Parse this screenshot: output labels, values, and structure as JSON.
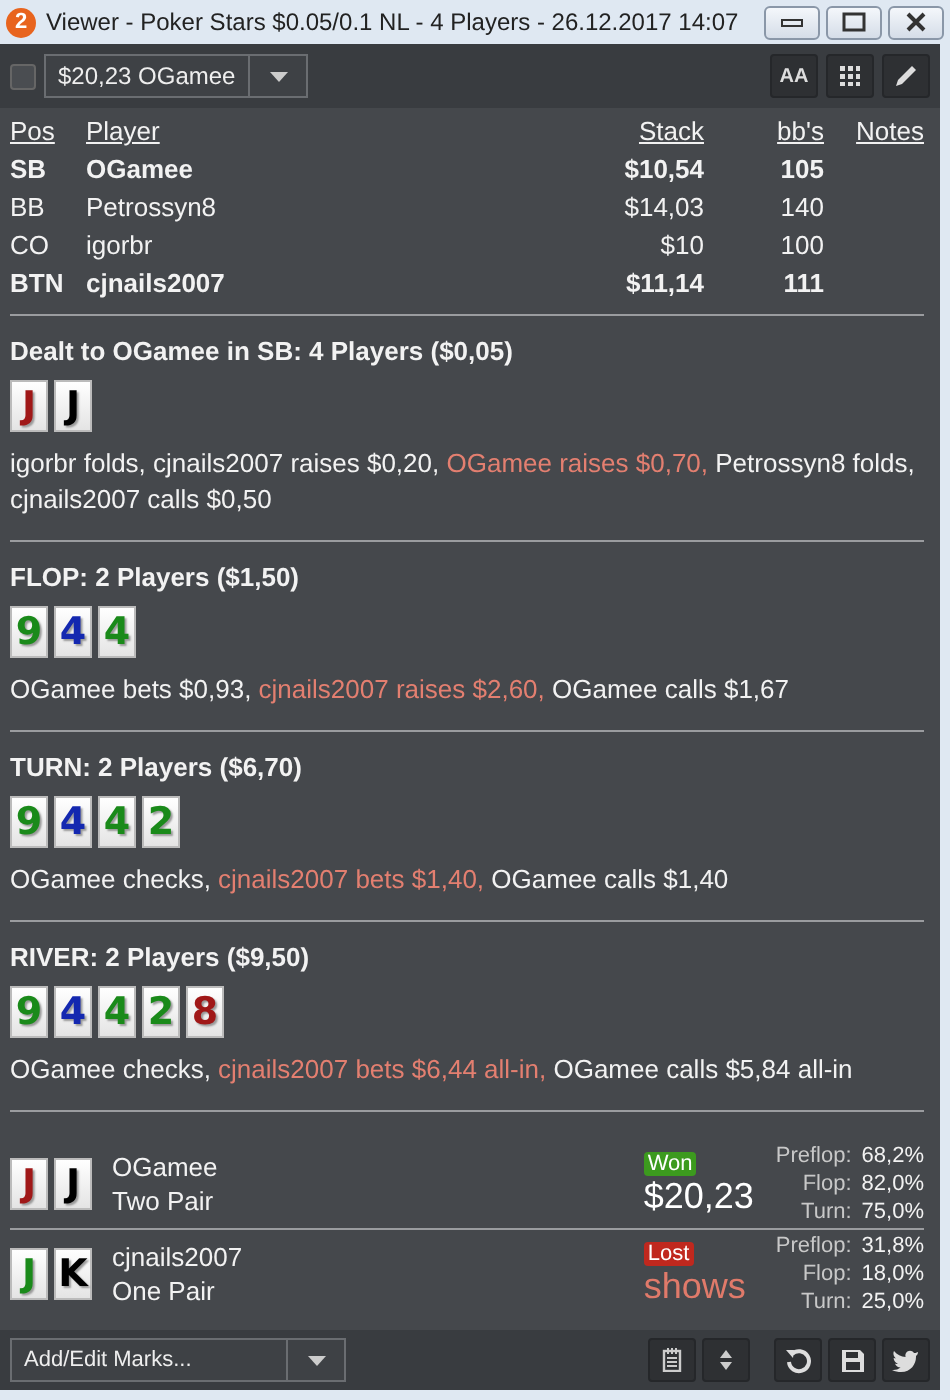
{
  "window": {
    "badge": "2",
    "title": "Viewer - Poker Stars $0.05/0.1 NL - 4 Players - 26.12.2017 14:07"
  },
  "toolbar": {
    "checked": false,
    "hand_select": "$20,23 OGamee",
    "font_button": "AA"
  },
  "players": {
    "columns": [
      "Pos",
      "Player",
      "Stack",
      "bb's",
      "Notes"
    ],
    "rows": [
      {
        "pos": "SB",
        "name": "OGamee",
        "stack": "$10,54",
        "bbs": "105",
        "bold": true
      },
      {
        "pos": "BB",
        "name": "Petrossyn8",
        "stack": "$14,03",
        "bbs": "140",
        "bold": false
      },
      {
        "pos": "CO",
        "name": "igorbr",
        "stack": "$10",
        "bbs": "100",
        "bold": false
      },
      {
        "pos": "BTN",
        "name": "cjnails2007",
        "stack": "$11,14",
        "bbs": "111",
        "bold": true
      }
    ]
  },
  "streets": [
    {
      "title": "Dealt to OGamee in SB: 4 Players ($0,05)",
      "cards": [
        {
          "rank": "J",
          "color": "#a01818"
        },
        {
          "rank": "J",
          "color": "#000000"
        }
      ],
      "actions": [
        {
          "text": "igorbr folds, cjnails2007 raises $0,20, ",
          "highlighted": false
        },
        {
          "text": "OGamee raises $0,70, ",
          "highlighted": true
        },
        {
          "text": "Petrossyn8 folds, cjnails2007 calls $0,50",
          "highlighted": false
        }
      ]
    },
    {
      "title": "FLOP: 2 Players ($1,50)",
      "cards": [
        {
          "rank": "9",
          "color": "#1a8a1a"
        },
        {
          "rank": "4",
          "color": "#1428b0"
        },
        {
          "rank": "4",
          "color": "#1a8a1a"
        }
      ],
      "actions": [
        {
          "text": "OGamee bets $0,93, ",
          "highlighted": false
        },
        {
          "text": "cjnails2007 raises $2,60, ",
          "highlighted": true
        },
        {
          "text": "OGamee calls $1,67",
          "highlighted": false
        }
      ]
    },
    {
      "title": "TURN: 2 Players ($6,70)",
      "cards": [
        {
          "rank": "9",
          "color": "#1a8a1a"
        },
        {
          "rank": "4",
          "color": "#1428b0"
        },
        {
          "rank": "4",
          "color": "#1a8a1a"
        },
        {
          "rank": "2",
          "color": "#1a8a1a"
        }
      ],
      "actions": [
        {
          "text": "OGamee checks, ",
          "highlighted": false
        },
        {
          "text": "cjnails2007 bets $1,40, ",
          "highlighted": true
        },
        {
          "text": "OGamee calls $1,40",
          "highlighted": false
        }
      ]
    },
    {
      "title": "RIVER: 2 Players ($9,50)",
      "cards": [
        {
          "rank": "9",
          "color": "#1a8a1a"
        },
        {
          "rank": "4",
          "color": "#1428b0"
        },
        {
          "rank": "4",
          "color": "#1a8a1a"
        },
        {
          "rank": "2",
          "color": "#1a8a1a"
        },
        {
          "rank": "8",
          "color": "#a01818"
        }
      ],
      "actions": [
        {
          "text": "OGamee checks, ",
          "highlighted": false
        },
        {
          "text": "cjnails2007 bets $6,44 all-in, ",
          "highlighted": true
        },
        {
          "text": "OGamee calls $5,84 all-in",
          "highlighted": false
        }
      ]
    }
  ],
  "showdown": [
    {
      "cards": [
        {
          "rank": "J",
          "color": "#a01818"
        },
        {
          "rank": "J",
          "color": "#000000"
        }
      ],
      "name": "OGamee",
      "hand": "Two Pair",
      "won": true,
      "badge": "Won",
      "amount": "$20,23",
      "equity": [
        {
          "label": "Preflop:",
          "value": "68,2%"
        },
        {
          "label": "Flop:",
          "value": "82,0%"
        },
        {
          "label": "Turn:",
          "value": "75,0%"
        }
      ]
    },
    {
      "cards": [
        {
          "rank": "J",
          "color": "#1a8a1a"
        },
        {
          "rank": "K",
          "color": "#000000"
        }
      ],
      "name": "cjnails2007",
      "hand": "One Pair",
      "won": false,
      "badge": "Lost",
      "amount": "shows",
      "equity": [
        {
          "label": "Preflop:",
          "value": "31,8%"
        },
        {
          "label": "Flop:",
          "value": "18,0%"
        },
        {
          "label": "Turn:",
          "value": "25,0%"
        }
      ]
    }
  ],
  "bottom_bar": {
    "marks_select": "Add/Edit Marks..."
  }
}
